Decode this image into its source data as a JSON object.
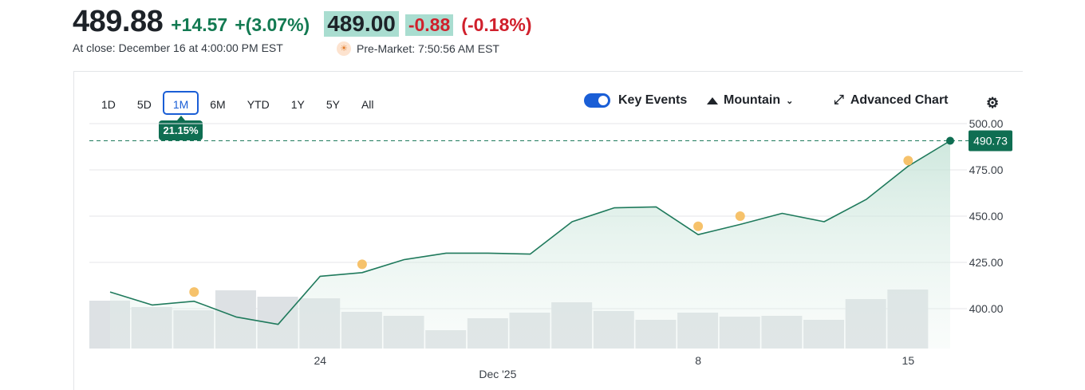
{
  "quote": {
    "price": "489.88",
    "change": "+14.57",
    "change_pct": "+(3.07%)",
    "close_label": "At close: December 16 at 4:00:00 PM EST",
    "pre_price": "489.00",
    "pre_change": "-0.88",
    "pre_change_pct": "(-0.18%)",
    "pre_label": "Pre-Market: 7:50:56 AM EST"
  },
  "ranges": [
    {
      "label": "1D",
      "active": false
    },
    {
      "label": "5D",
      "active": false
    },
    {
      "label": "1M",
      "active": true
    },
    {
      "label": "6M",
      "active": false
    },
    {
      "label": "YTD",
      "active": false
    },
    {
      "label": "1Y",
      "active": false
    },
    {
      "label": "5Y",
      "active": false
    },
    {
      "label": "All",
      "active": false
    }
  ],
  "range_performance": "21.15%",
  "toolbar": {
    "key_events": "Key Events",
    "key_events_on": true,
    "chart_style": "Mountain",
    "advanced": "Advanced Chart"
  },
  "icons": [
    "sun-icon",
    "mountain-icon",
    "chevron-down-icon",
    "expand-icon",
    "gear-icon"
  ],
  "colors": {
    "up": "#137a52",
    "down": "#d0202c",
    "line": "#1f7a5c",
    "event": "#f6c26b",
    "volume": "#dde1e4",
    "accent": "#1a5ed6",
    "highlight": "#a9ddd0"
  },
  "chart_data": {
    "type": "area",
    "x_labels": [
      {
        "label": "24",
        "index": 5
      },
      {
        "label": "8",
        "index": 14
      },
      {
        "label": "15",
        "index": 19
      }
    ],
    "x_sublabel": {
      "label": "Dec '25",
      "index": 9
    },
    "ylim": [
      382,
      502
    ],
    "y_ticks": [
      500,
      475,
      450,
      425,
      400
    ],
    "y_tick_labels": [
      "500.00",
      "475.00",
      "450.00",
      "425.00",
      "400.00"
    ],
    "grid": true,
    "price_axis": "right",
    "series": [
      {
        "values": [
          409,
          402,
          404,
          395.5,
          391.5,
          417.5,
          419.5,
          426.5,
          430,
          430,
          429.5,
          447,
          454.5,
          455,
          440,
          445.5,
          451.5,
          447,
          459,
          477,
          490.73
        ]
      }
    ],
    "current_value": "490.73",
    "volume": [
      0.6,
      0.52,
      0.48,
      0.73,
      0.65,
      0.63,
      0.46,
      0.41,
      0.23,
      0.38,
      0.45,
      0.58,
      0.47,
      0.36,
      0.45,
      0.4,
      0.41,
      0.36,
      0.62,
      0.74
    ],
    "events": [
      {
        "index": 2,
        "value": 409
      },
      {
        "index": 6,
        "value": 424
      },
      {
        "index": 14,
        "value": 444.5
      },
      {
        "index": 15,
        "value": 450
      },
      {
        "index": 19,
        "value": 480
      }
    ]
  }
}
